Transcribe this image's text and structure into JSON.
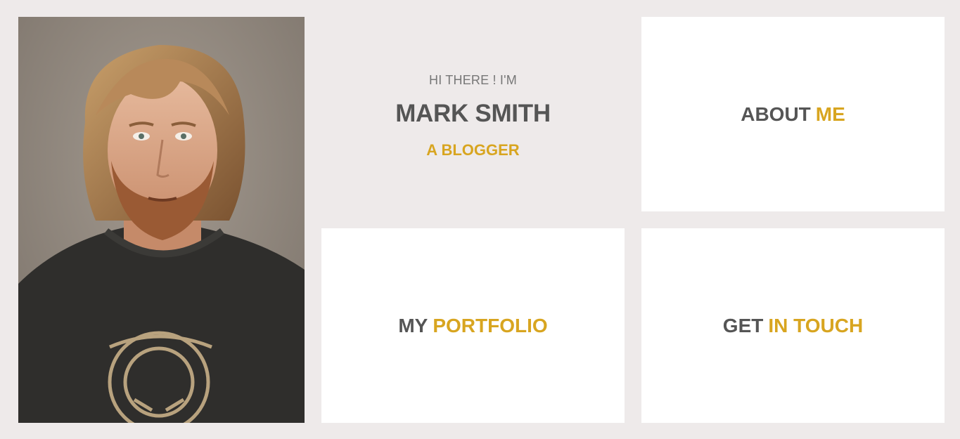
{
  "intro": {
    "greeting": "HI THERE ! I'M",
    "name": "MARK SMITH",
    "role": "A BLOGGER"
  },
  "cards": {
    "about": {
      "lead": "ABOUT",
      "accent": "ME"
    },
    "portfolio": {
      "lead": "MY",
      "accent": "PORTFOLIO"
    },
    "contact": {
      "lead": "GET",
      "accent": "IN TOUCH"
    }
  },
  "colors": {
    "background": "#eeeaea",
    "card": "#ffffff",
    "text": "#555555",
    "accent": "#d8a520"
  },
  "portrait": {
    "icon": "person-photo"
  }
}
